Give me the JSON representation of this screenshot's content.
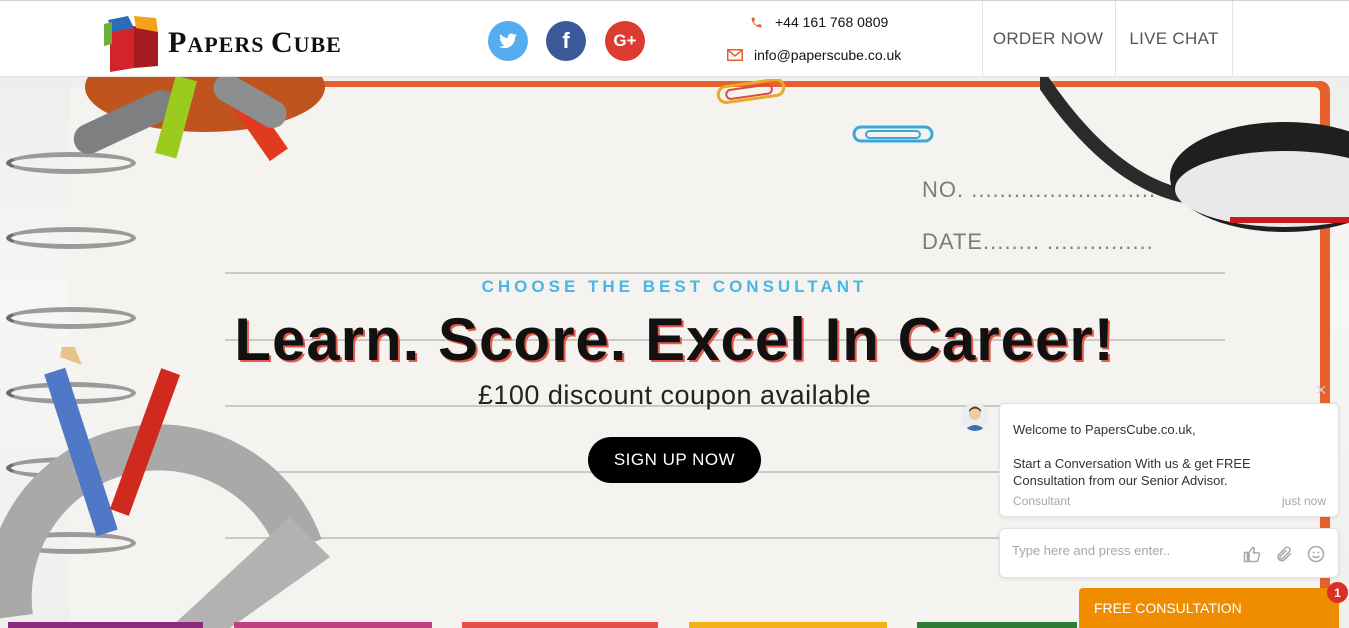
{
  "header": {
    "logo": {
      "part1_initial": "P",
      "part1_rest": "APERS",
      "part2_initial": "C",
      "part2_rest": "UBE"
    },
    "social": [
      {
        "name": "twitter",
        "glyph": "t",
        "color": "#55acee"
      },
      {
        "name": "facebook",
        "glyph": "f",
        "color": "#3b5998"
      },
      {
        "name": "google-plus",
        "glyph": "G+",
        "color": "#dc3b2f"
      }
    ],
    "phone": "+44 161 768 0809",
    "email": "info@paperscube.co.uk",
    "nav": {
      "order_label": "ORDER NOW",
      "live_chat_label": "LIVE CHAT"
    },
    "accent_color": "#e8612c"
  },
  "hero": {
    "tagline": "CHOOSE THE BEST CONSULTANT",
    "headline": "Learn. Score. Excel In Career!",
    "subline": "£100 discount coupon available",
    "cta_label": "SIGN UP NOW",
    "notebook_labels": {
      "no": "NO. ..........................",
      "date": "DATE........ ..............."
    },
    "bottom_bar_colors": [
      "#8e2a7e",
      "#c2407f",
      "#e4514a",
      "#f3b01a",
      "#2e7d32"
    ]
  },
  "chat": {
    "close_glyph": "×",
    "welcome": "Welcome to PapersCube.co.uk,",
    "message": "Start a Conversation With us & get FREE Consultation from our Senior Advisor.",
    "sender": "Consultant",
    "time": "just now",
    "input_placeholder": "Type here and press enter..",
    "free_consultation_label": "FREE CONSULTATION",
    "unread_count": "1"
  }
}
